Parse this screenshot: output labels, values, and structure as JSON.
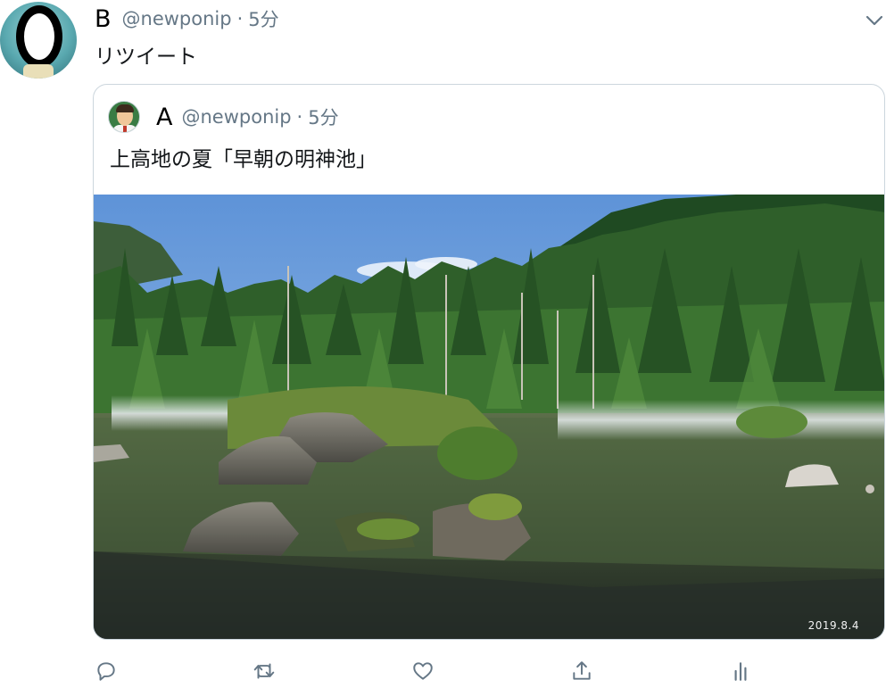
{
  "tweet": {
    "display_name": "B",
    "handle": "@newponip",
    "separator": "·",
    "time": "5分",
    "text": "リツイート"
  },
  "quoted": {
    "display_name": "A",
    "handle": "@newponip",
    "separator": "·",
    "time": "5分",
    "text": "上高地の夏「早朝の明神池」",
    "photo_date_stamp": "2019.8.4"
  },
  "icons": {
    "menu": "chevron-down-icon",
    "reply": "reply-icon",
    "retweet": "retweet-icon",
    "like": "heart-icon",
    "share": "share-icon",
    "analytics": "analytics-icon"
  },
  "colors": {
    "secondary_text": "#657786",
    "border": "#ccd6dd",
    "icon": "#657786"
  }
}
